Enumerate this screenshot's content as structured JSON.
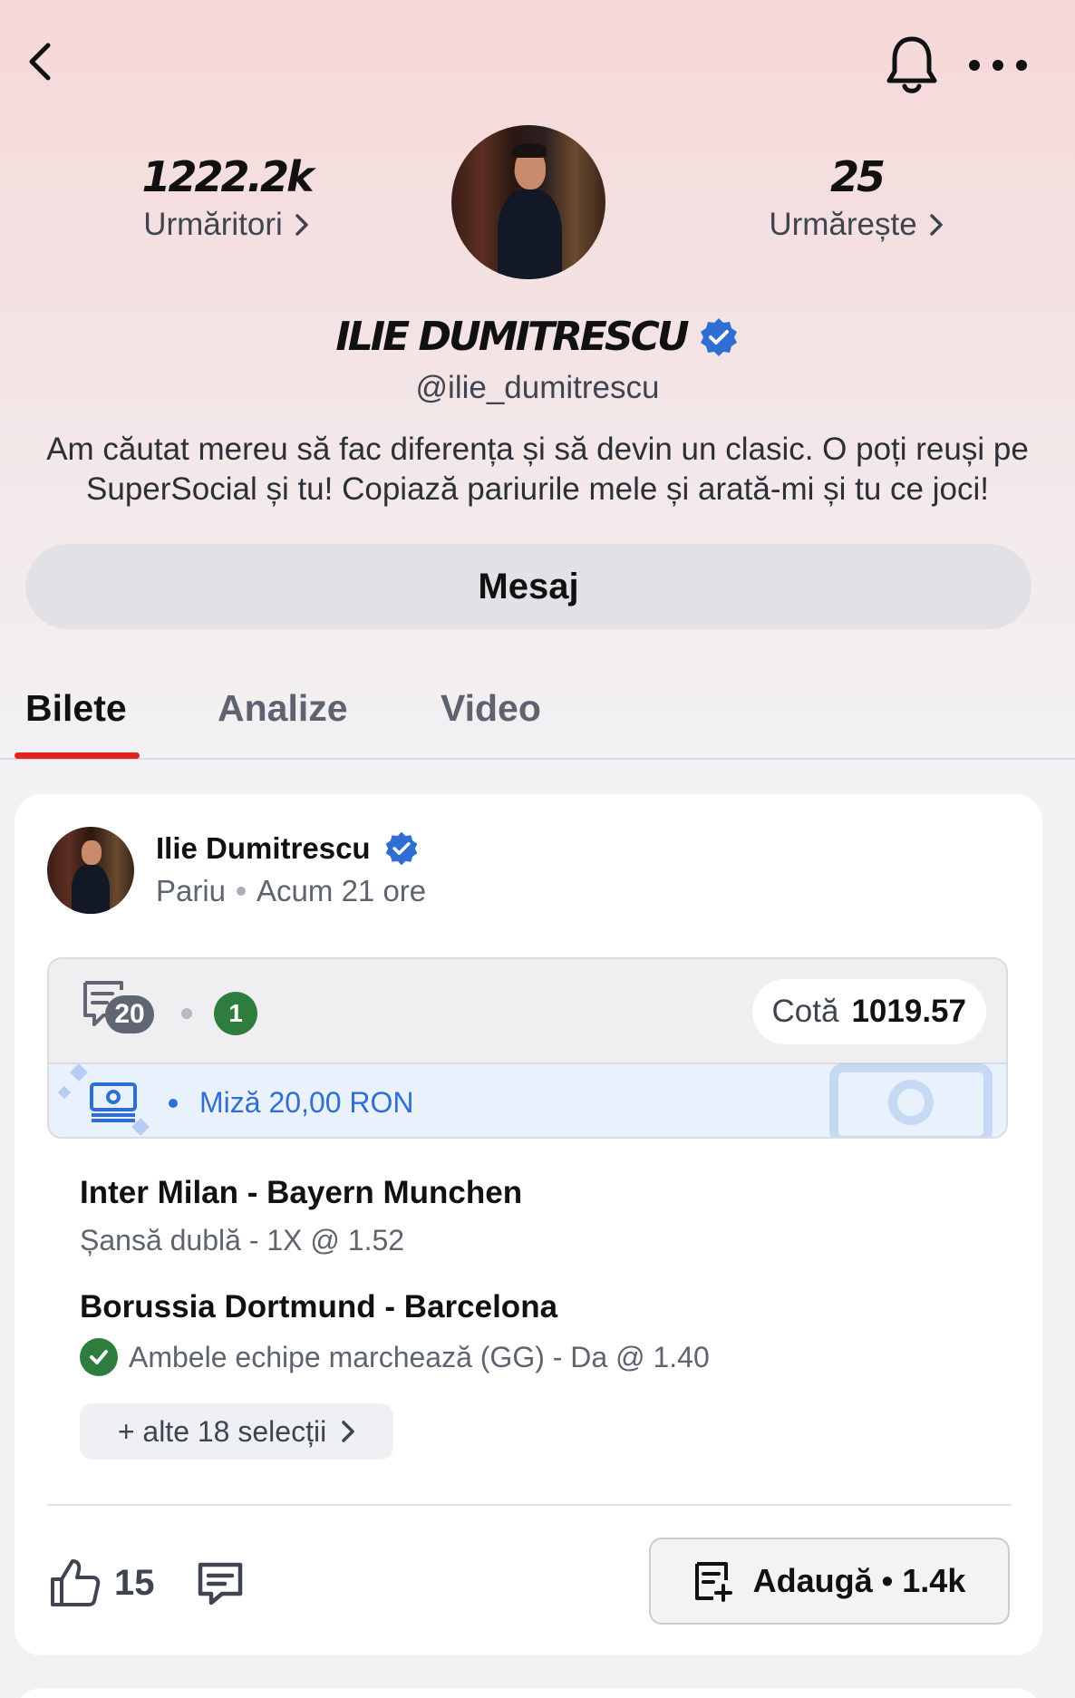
{
  "header": {
    "followers_count": "1222.2k",
    "followers_label": "Urmăritori",
    "following_count": "25",
    "following_label": "Urmărește"
  },
  "profile": {
    "name": "ILIE DUMITRESCU",
    "handle": "@ilie_dumitrescu",
    "bio": "Am căutat mereu să fac diferența și să devin un clasic. O poți reuși pe SuperSocial și tu! Copiază pariurile mele și arată-mi și tu ce joci!",
    "message_button": "Mesaj"
  },
  "tabs": [
    {
      "label": "Bilete",
      "active": true
    },
    {
      "label": "Analize",
      "active": false
    },
    {
      "label": "Video",
      "active": false
    }
  ],
  "post": {
    "author": "Ilie Dumitrescu",
    "type": "Pariu",
    "time": "Acum 21 ore",
    "ticket": {
      "selections_count": "20",
      "won_count": "1",
      "odds_label": "Cotă",
      "odds_value": "1019.57",
      "stake": "Miză 20,00 RON"
    },
    "matches": [
      {
        "title": "Inter Milan - Bayern Munchen",
        "pick": "Șansă dublă - 1X @ 1.52",
        "won": false
      },
      {
        "title": "Borussia Dortmund - Barcelona",
        "pick": "Ambele echipe marchează (GG) - Da @ 1.40",
        "won": true
      }
    ],
    "more_selections": "+ alte 18 selecții",
    "likes": "15",
    "add_button": "Adaugă • 1.4k"
  },
  "colors": {
    "accent_red": "#e2231a",
    "win_green": "#2e7d3e",
    "stake_blue": "#2f6fd4",
    "verified_blue": "#2f6fd4"
  },
  "icons": [
    "back-icon",
    "bell-icon",
    "more-icon",
    "chevron-right-icon",
    "verified-icon",
    "ticket-icon",
    "money-icon",
    "check-icon",
    "thumbs-up-icon",
    "comment-icon",
    "add-ticket-icon"
  ]
}
